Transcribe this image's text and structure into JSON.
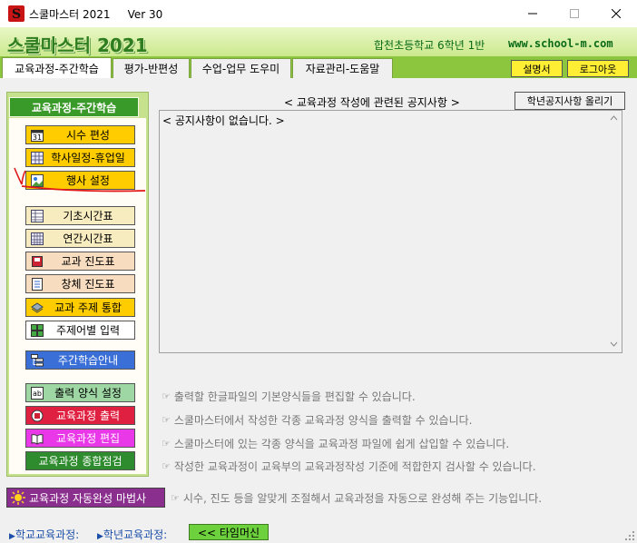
{
  "window": {
    "title": "스쿨마스터 2021     Ver 30"
  },
  "banner": {
    "logo": "스쿨마스터 2021",
    "school": "합천초등학교 6학년 1반",
    "url": "www.school-m.com"
  },
  "tabs": [
    {
      "label": "교육과정-주간학습",
      "active": true
    },
    {
      "label": "평가-반편성"
    },
    {
      "label": "수업-업무 도우미"
    },
    {
      "label": "자료관리-도움말"
    }
  ],
  "tab_buttons": {
    "manual": "설명서",
    "logout": "로그아웃"
  },
  "sidebar": {
    "header": "교육과정-주간학습",
    "buttons": [
      {
        "label": "시수 편성",
        "icon": "calendar-31-icon",
        "color": "#ffcc00"
      },
      {
        "label": "학사일정-휴업일",
        "icon": "calendar-grid-icon",
        "color": "#ffcc00"
      },
      {
        "label": "행사 설정",
        "icon": "image-icon",
        "color": "#ffcc00"
      },
      {
        "label": "기초시간표",
        "icon": "table-icon",
        "color": "#f7ebc0"
      },
      {
        "label": "연간시간표",
        "icon": "table-grid-icon",
        "color": "#f7ebc0"
      },
      {
        "label": "교과 진도표",
        "icon": "book-icon",
        "color": "#f7dcc0"
      },
      {
        "label": "창체 진도표",
        "icon": "list-icon",
        "color": "#f7dcc0"
      },
      {
        "label": "교과 주제 통합",
        "icon": "layers-icon",
        "color": "#ffcc00"
      },
      {
        "label": "주제어별 입력",
        "icon": "grid-icon",
        "color": "#ffffff"
      },
      {
        "label": "주간학습안내",
        "icon": "tree-icon",
        "color": "#3a6fd8"
      },
      {
        "label": "출력 양식 설정",
        "icon": "text-ab-icon",
        "color": "#9ed6a4"
      },
      {
        "label": "교육과정 출력",
        "icon": "print-icon",
        "color": "#e02040"
      },
      {
        "label": "교육과정 편집",
        "icon": "book-open-icon",
        "color": "#e838e8"
      },
      {
        "label": "교육과정 종합점검",
        "icon": "",
        "color": "#2e8b2e"
      }
    ]
  },
  "notice": {
    "title": "< 교육과정 작성에 관련된 공지사항 >",
    "upload_button": "학년공지사항 올리기",
    "content": "< 공지사항이 없습니다. >"
  },
  "info_lines": [
    "출력할 한글파일의 기본양식들을 편집할 수 있습니다.",
    "스쿨마스터에서 작성한 각종 교육과정 양식을 출력할 수 있습니다.",
    "스쿨마스터에 있는 각종 양식을 교육과정 파일에 쉽게 삽입할 수 있습니다.",
    "작성한 교육과정이 교육부의 교육과정작성 기준에 적합한지 검사할 수 있습니다."
  ],
  "wizard": {
    "label": "교육과정 자동완성 마법사",
    "note": "시수, 진도 등을 알맞게 조절해서 교육과정을 자동으로 완성해 주는 기능입니다."
  },
  "status": {
    "school_curriculum": "학교교육과정:",
    "grade_curriculum": "학년교육과정:",
    "time_machine": "<< 타임머신"
  }
}
